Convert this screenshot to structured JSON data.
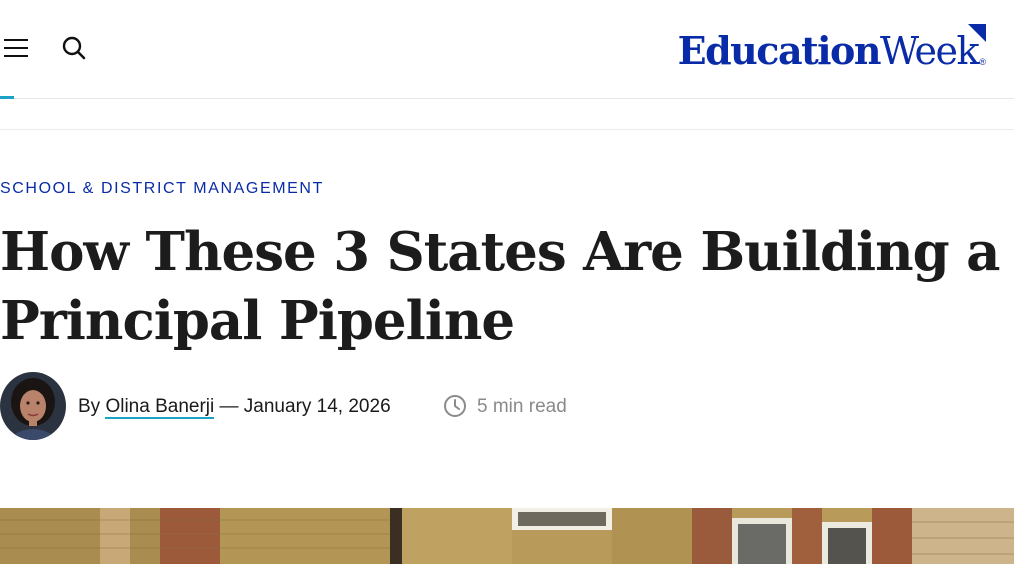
{
  "header": {
    "menu_icon": "hamburger-menu-icon",
    "search_icon": "search-icon",
    "logo": {
      "part1": "Education",
      "part2": "Week",
      "reg": "®"
    },
    "brand_color": "#0a2ba8",
    "accent_color": "#1aa3c4"
  },
  "article": {
    "category": "SCHOOL & DISTRICT MANAGEMENT",
    "title_line1": "How These 3 States Are Building a",
    "title_line2": "Principal Pipeline",
    "byline": {
      "prefix": "By ",
      "author": "Olina Banerji",
      "separator": " — ",
      "date": "January 14, 2026",
      "read_time": "5 min read",
      "clock_icon": "clock-icon"
    }
  }
}
